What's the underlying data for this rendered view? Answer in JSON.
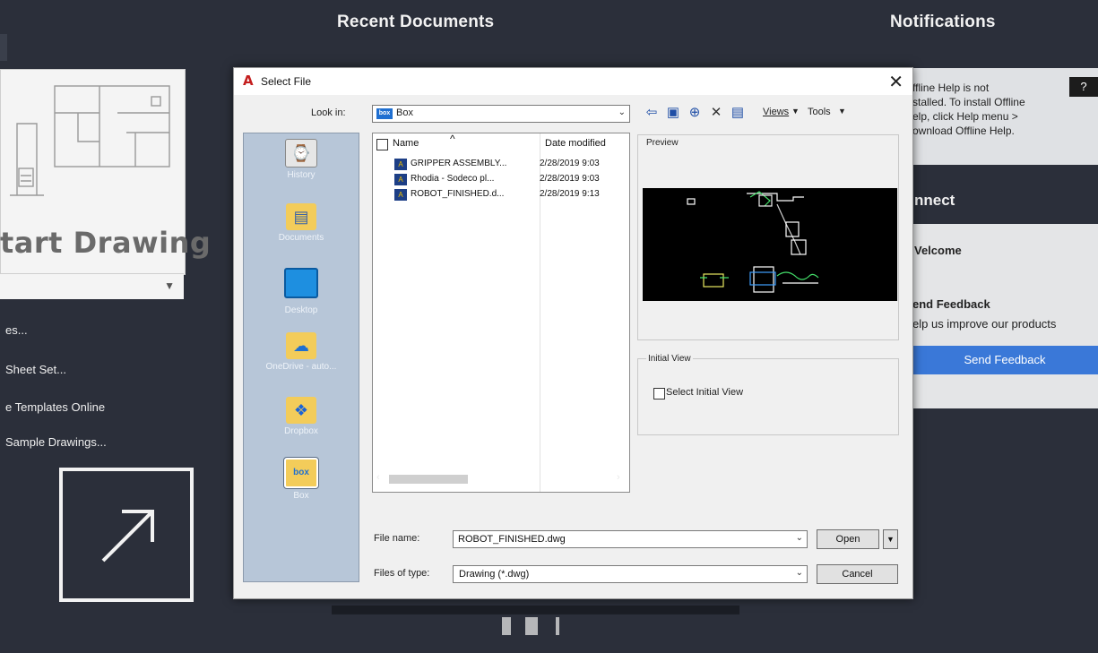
{
  "background_color": "#2b2f3a",
  "headers": {
    "recent_documents": "Recent Documents",
    "notifications": "Notifications"
  },
  "left_panel": {
    "start_drawing": "tart Drawing",
    "links": [
      "es...",
      "Sheet Set...",
      "e Templates Online",
      "Sample Drawings..."
    ]
  },
  "notifications": {
    "help_text": "ffline Help is not\nstalled. To install Offline\nelp, click Help menu >\nownload Offline Help.",
    "help_button": "?"
  },
  "connect": {
    "title": "nnect",
    "welcome": "Velcome",
    "feedback_title": "end Feedback",
    "feedback_desc": "elp us improve our products",
    "send_feedback_button": "Send Feedback"
  },
  "dialog": {
    "title": "Select File",
    "close": "✕",
    "look_in_label": "Look in:",
    "look_in_value": "Box",
    "toolbar": {
      "views": "Views",
      "tools": "Tools"
    },
    "places": [
      "History",
      "Documents",
      "Desktop",
      "OneDrive - auto...",
      "Dropbox",
      "Box"
    ],
    "columns": {
      "name": "Name",
      "date": "Date modified"
    },
    "files": [
      {
        "name": "GRIPPER ASSEMBLY...",
        "date": "2/28/2019 9:03"
      },
      {
        "name": "Rhodia - Sodeco pl...",
        "date": "2/28/2019 9:03"
      },
      {
        "name": "ROBOT_FINISHED.d...",
        "date": "2/28/2019 9:13"
      }
    ],
    "preview_label": "Preview",
    "initial_view_label": "Initial View",
    "select_initial_view": "Select Initial View",
    "file_name_label": "File name:",
    "file_name_value": "ROBOT_FINISHED.dwg",
    "files_of_type_label": "Files of type:",
    "files_of_type_value": "Drawing (*.dwg)",
    "open_button": "Open",
    "cancel_button": "Cancel"
  }
}
